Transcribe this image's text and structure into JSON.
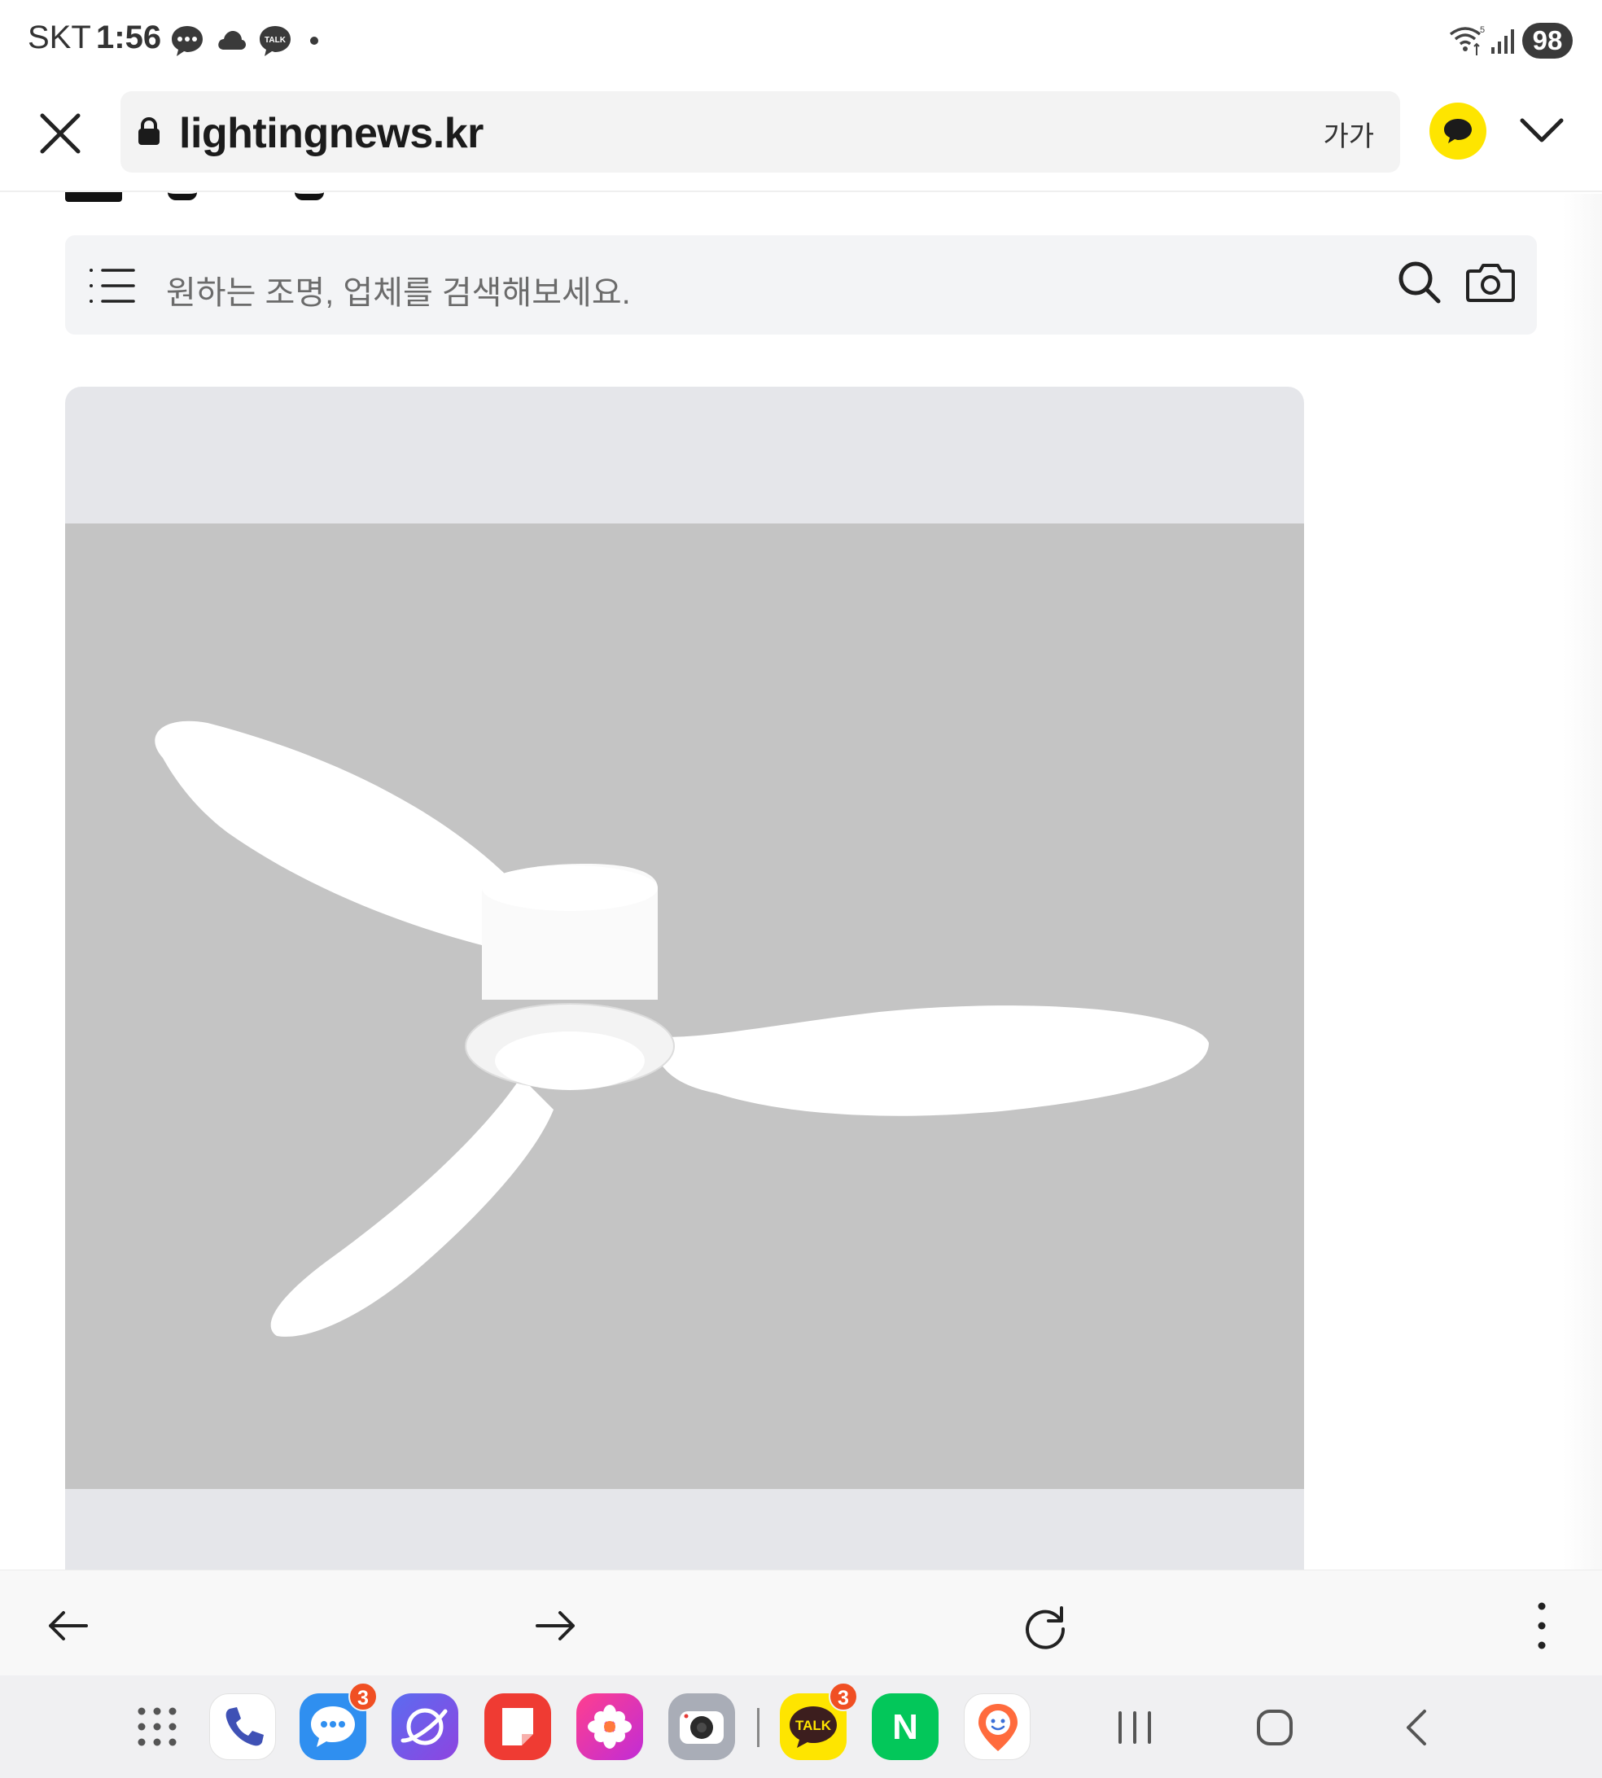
{
  "status_bar": {
    "carrier": "SKT",
    "time": "1:56",
    "battery": "98",
    "icons": [
      "message-icon",
      "cloud-icon",
      "kakaotalk-icon",
      "dot-icon",
      "wifi-icon",
      "signal-icon"
    ]
  },
  "browser": {
    "url": "lightingnews.kr",
    "text_size_label": "가가",
    "icons": [
      "close-icon",
      "lock-icon",
      "kakao-chat-icon",
      "chevron-down-icon"
    ]
  },
  "page": {
    "search_placeholder": "원하는 조명, 업체를 검색해보세요.",
    "icons": [
      "menu-icon",
      "search-icon",
      "camera-icon"
    ],
    "product_image": "white three-blade ceiling fan with LED light"
  },
  "browser_nav": {
    "icons": [
      "back-arrow-icon",
      "forward-arrow-icon",
      "refresh-icon",
      "more-options-icon"
    ]
  },
  "dock": {
    "apps": [
      {
        "name": "app-drawer",
        "badge": ""
      },
      {
        "name": "phone",
        "badge": ""
      },
      {
        "name": "messages",
        "badge": "3"
      },
      {
        "name": "internet",
        "badge": ""
      },
      {
        "name": "notes",
        "badge": ""
      },
      {
        "name": "gallery",
        "badge": ""
      },
      {
        "name": "camera",
        "badge": ""
      },
      {
        "name": "kakaotalk",
        "badge": "3",
        "label": "TALK"
      },
      {
        "name": "naver",
        "badge": "",
        "label": "N"
      },
      {
        "name": "map-app",
        "badge": ""
      }
    ],
    "system_nav": [
      "recent-apps-icon",
      "home-icon",
      "back-icon"
    ]
  },
  "colors": {
    "kakao_yellow": "#fee500",
    "badge_red": "#f04f23",
    "naver_green": "#03c75a",
    "card_bg": "#e5e6ea",
    "image_bg": "#c4c4c4"
  }
}
